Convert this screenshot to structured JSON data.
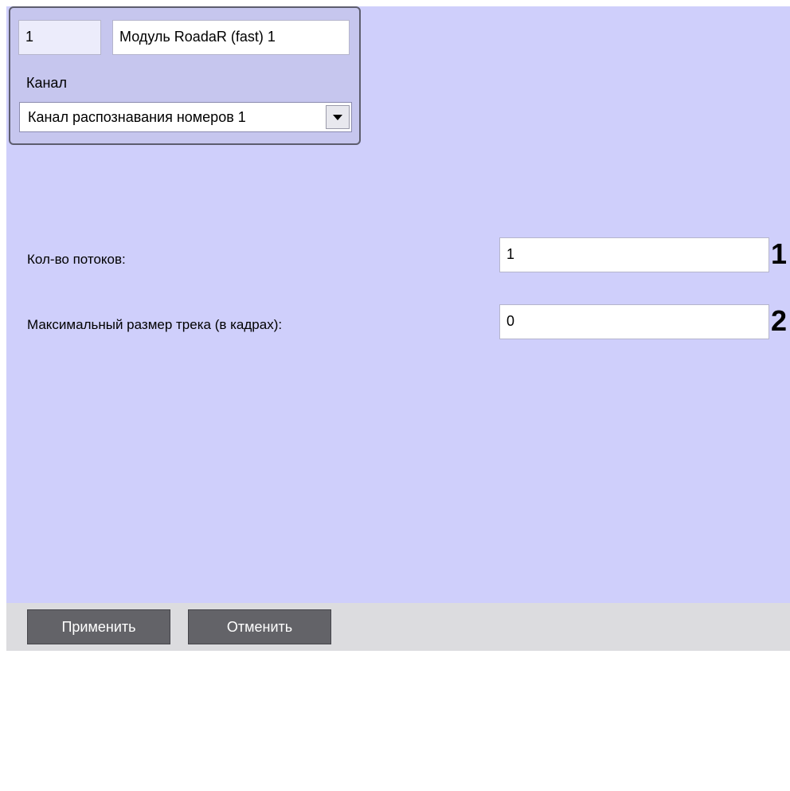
{
  "header": {
    "id_value": "1",
    "name_value": "Модуль RoadaR (fast) 1",
    "channel_label": "Канал",
    "channel_selected": "Канал распознавания номеров 1"
  },
  "settings": {
    "threads_label": "Кол-во потоков:",
    "threads_value": "1",
    "threads_marker": "1",
    "max_track_label": "Максимальный размер трека (в кадрах):",
    "max_track_value": "0",
    "max_track_marker": "2"
  },
  "footer": {
    "apply_label": "Применить",
    "cancel_label": "Отменить"
  },
  "colors": {
    "panel_bg": "#cfcffb",
    "button_bg": "#636368"
  },
  "icons": {
    "dropdown": "chevron-down-icon"
  }
}
